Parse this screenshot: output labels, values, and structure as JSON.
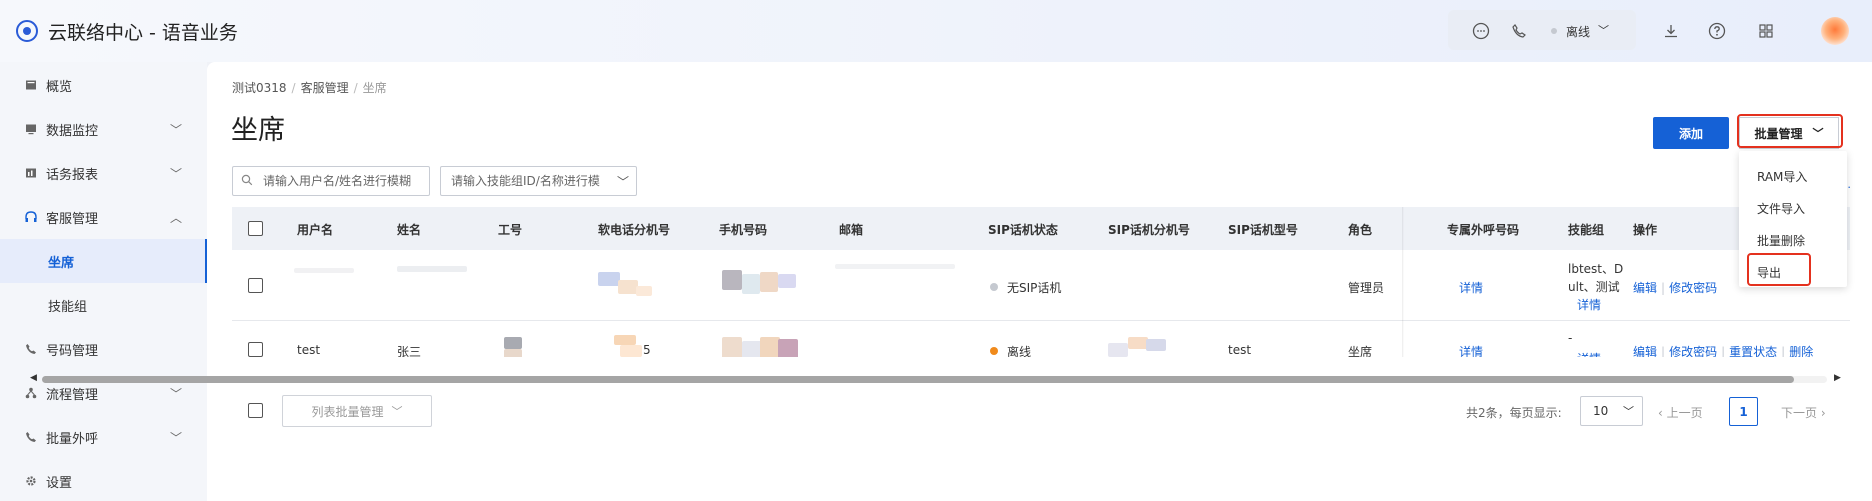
{
  "app": {
    "title": "云联络中心 - 语音业务"
  },
  "topbar": {
    "status": "离线"
  },
  "sidebar": {
    "items": [
      {
        "label": "概览",
        "icon": "overview-icon"
      },
      {
        "label": "数据监控",
        "icon": "monitor-icon"
      },
      {
        "label": "话务报表",
        "icon": "report-icon"
      },
      {
        "label": "客服管理",
        "icon": "headset-icon"
      },
      {
        "label": "坐席",
        "active": true
      },
      {
        "label": "技能组"
      },
      {
        "label": "号码管理",
        "icon": "phone-icon"
      },
      {
        "label": "流程管理",
        "icon": "flow-icon"
      },
      {
        "label": "批量外呼",
        "icon": "batch-call-icon"
      },
      {
        "label": "设置",
        "icon": "gear-icon"
      }
    ]
  },
  "breadcrumb": [
    "测试0318",
    "客服管理",
    "坐席"
  ],
  "page": {
    "title": "坐席"
  },
  "toolbar": {
    "add_label": "添加",
    "batch_label": "批量管理",
    "batch_menu": [
      "RAM导入",
      "文件导入",
      "批量删除",
      "导出"
    ]
  },
  "filters": {
    "user_placeholder": "请输入用户名/姓名进行模糊",
    "skill_placeholder": "请输入技能组ID/名称进行模"
  },
  "table": {
    "columns": [
      "用户名",
      "姓名",
      "工号",
      "软电话分机号",
      "手机号码",
      "邮箱",
      "SIP话机状态",
      "SIP话机分机号",
      "SIP话机型号",
      "角色",
      "专属外呼号码",
      "技能组",
      "操作"
    ],
    "rows": [
      {
        "sip_status": "无SIP话机",
        "role": "管理员",
        "detail": "详情",
        "skill_line1": "lbtest、D",
        "skill_line2": "ult、测试",
        "skill_detail": "详情",
        "ops": [
          "编辑",
          "修改密码"
        ]
      },
      {
        "username": "test",
        "name": "张三",
        "softphone_partial": "5",
        "sip_status": "离线",
        "sip_model": "test",
        "role": "坐席",
        "detail": "详情",
        "skill_line1": "-",
        "skill_detail": "详情",
        "ops": [
          "编辑",
          "修改密码",
          "重置状态",
          "删除"
        ]
      }
    ]
  },
  "footer": {
    "list_batch_label": "列表批量管理",
    "total_text": "共2条，每页显示:",
    "page_size": "10",
    "prev_label": "上一页",
    "current_page": "1",
    "next_label": "下一页"
  },
  "colors": {
    "primary": "#1561d6",
    "highlight": "#e4311e",
    "offline_dot": "#f08a1c",
    "no_sip_dot": "#c5c9d0"
  }
}
